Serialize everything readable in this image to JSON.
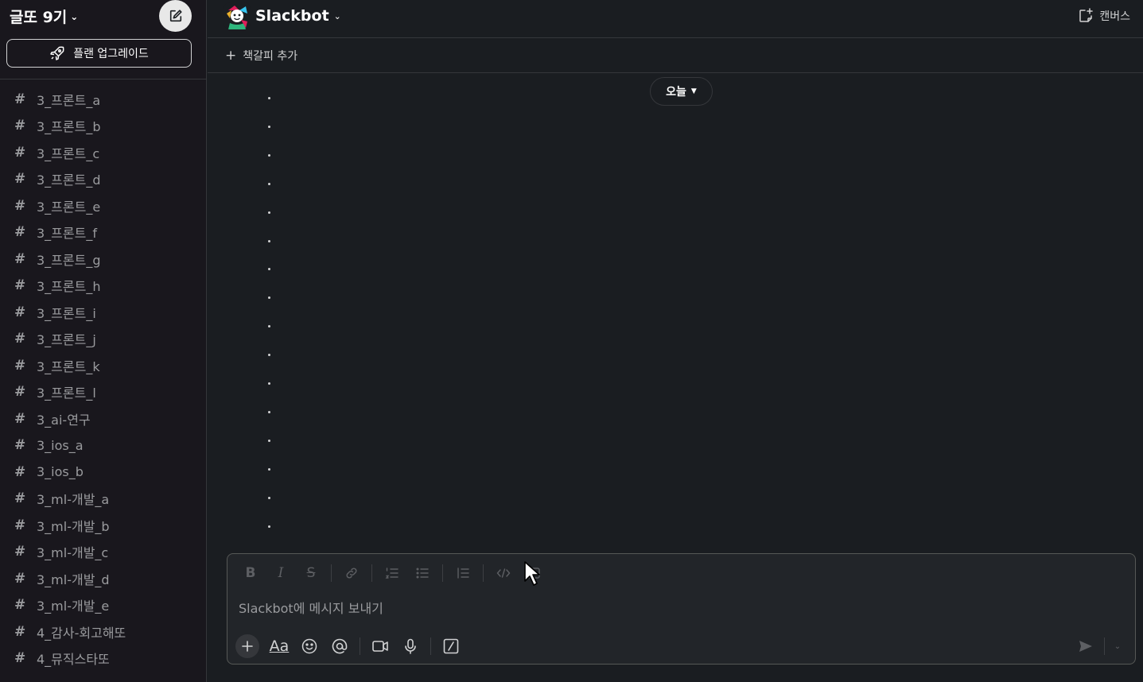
{
  "workspace": {
    "name": "글또 9기",
    "upgrade_label": "플랜 업그레이드"
  },
  "sidebar": {
    "channels": [
      {
        "label": "3_프론트_a"
      },
      {
        "label": "3_프론트_b"
      },
      {
        "label": "3_프론트_c"
      },
      {
        "label": "3_프론트_d"
      },
      {
        "label": "3_프론트_e"
      },
      {
        "label": "3_프론트_f"
      },
      {
        "label": "3_프론트_g"
      },
      {
        "label": "3_프론트_h"
      },
      {
        "label": "3_프론트_i"
      },
      {
        "label": "3_프론트_j"
      },
      {
        "label": "3_프론트_k"
      },
      {
        "label": "3_프론트_l"
      },
      {
        "label": "3_ai-연구"
      },
      {
        "label": "3_ios_a"
      },
      {
        "label": "3_ios_b"
      },
      {
        "label": "3_ml-개발_a"
      },
      {
        "label": "3_ml-개발_b"
      },
      {
        "label": "3_ml-개발_c"
      },
      {
        "label": "3_ml-개발_d"
      },
      {
        "label": "3_ml-개발_e"
      },
      {
        "label": "4_감사-회고해또"
      },
      {
        "label": "4_뮤직스타또"
      }
    ]
  },
  "header": {
    "title": "Slackbot",
    "canvas_label": "캔버스"
  },
  "bookmarks": {
    "add_label": "책갈피 추가"
  },
  "timeline": {
    "day_label": "오늘",
    "message_dot_count": 16
  },
  "composer": {
    "placeholder": "Slackbot에 메시지 보내기",
    "format_buttons": [
      "bold",
      "italic",
      "strikethrough",
      "link",
      "ordered-list",
      "bulleted-list",
      "blockquote",
      "code",
      "code-block"
    ],
    "tools": [
      "plus",
      "formatting",
      "emoji",
      "mention",
      "video",
      "audio",
      "slash-command"
    ]
  },
  "colors": {
    "sidebar_bg": "#19171d",
    "main_bg": "#1a1d21",
    "composer_bg": "#222529",
    "text_primary": "#ffffff",
    "text_secondary": "#9a9b9e"
  }
}
